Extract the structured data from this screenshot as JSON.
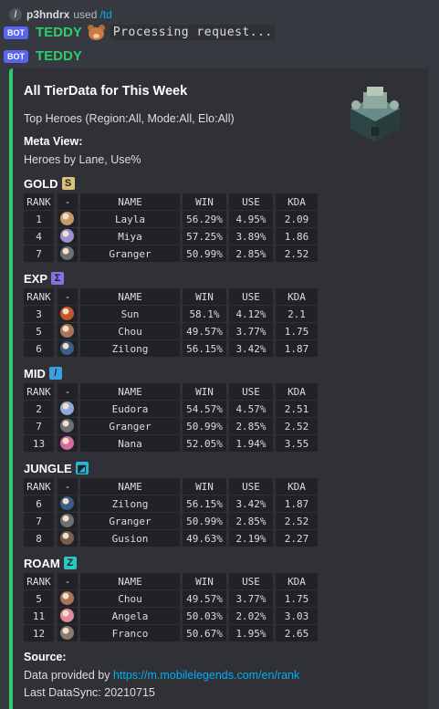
{
  "reply": {
    "slash": "/",
    "user": "p3hndrx",
    "used": "used",
    "command": "/td"
  },
  "bot": {
    "badge": "BOT",
    "name": "TEDDY",
    "processing": "Processing request..."
  },
  "embed": {
    "accent": "#2ecc71",
    "title": "All TierData for This Week",
    "subtitle": "Top Heroes (Region:All, Mode:All, Elo:All)",
    "meta_label": "Meta View:",
    "meta_value": "Heroes by Lane, Use%",
    "headers": {
      "rank": "RANK",
      "dash": "-",
      "name": "NAME",
      "win": "WIN",
      "use": "USE",
      "kda": "KDA"
    },
    "lanes": [
      {
        "title": "GOLD",
        "icon": "gold-lane-icon",
        "icon_color": "#d8c27a",
        "rows": [
          {
            "rank": "1",
            "name": "Layla",
            "win": "56.29%",
            "use": "4.95%",
            "kda": "2.09",
            "avatar": "#c9986a"
          },
          {
            "rank": "4",
            "name": "Miya",
            "win": "57.25%",
            "use": "3.89%",
            "kda": "1.86",
            "avatar": "#9b8fd6"
          },
          {
            "rank": "7",
            "name": "Granger",
            "win": "50.99%",
            "use": "2.85%",
            "kda": "2.52",
            "avatar": "#6d6f78"
          }
        ]
      },
      {
        "title": "EXP",
        "icon": "exp-lane-icon",
        "icon_color": "#8a6fe0",
        "rows": [
          {
            "rank": "3",
            "name": "Sun",
            "win": "58.1%",
            "use": "4.12%",
            "kda": "2.1",
            "avatar": "#c4552f"
          },
          {
            "rank": "5",
            "name": "Chou",
            "win": "49.57%",
            "use": "3.77%",
            "kda": "1.75",
            "avatar": "#a9745a"
          },
          {
            "rank": "6",
            "name": "Zilong",
            "win": "56.15%",
            "use": "3.42%",
            "kda": "1.87",
            "avatar": "#3d5d8a"
          }
        ]
      },
      {
        "title": "MID",
        "icon": "mid-lane-icon",
        "icon_color": "#3aa0e0",
        "rows": [
          {
            "rank": "2",
            "name": "Eudora",
            "win": "54.57%",
            "use": "4.57%",
            "kda": "2.51",
            "avatar": "#8fa9d8"
          },
          {
            "rank": "7",
            "name": "Granger",
            "win": "50.99%",
            "use": "2.85%",
            "kda": "2.52",
            "avatar": "#6d6f78"
          },
          {
            "rank": "13",
            "name": "Nana",
            "win": "52.05%",
            "use": "1.94%",
            "kda": "3.55",
            "avatar": "#d66aa0"
          }
        ]
      },
      {
        "title": "JUNGLE",
        "icon": "jungle-lane-icon",
        "icon_color": "#29b6d6",
        "rows": [
          {
            "rank": "6",
            "name": "Zilong",
            "win": "56.15%",
            "use": "3.42%",
            "kda": "1.87",
            "avatar": "#3d5d8a"
          },
          {
            "rank": "7",
            "name": "Granger",
            "win": "50.99%",
            "use": "2.85%",
            "kda": "2.52",
            "avatar": "#6d6f78"
          },
          {
            "rank": "8",
            "name": "Gusion",
            "win": "49.63%",
            "use": "2.19%",
            "kda": "2.27",
            "avatar": "#7a5e4c"
          }
        ]
      },
      {
        "title": "ROAM",
        "icon": "roam-lane-icon",
        "icon_color": "#2fc4c0",
        "rows": [
          {
            "rank": "5",
            "name": "Chou",
            "win": "49.57%",
            "use": "3.77%",
            "kda": "1.75",
            "avatar": "#a9745a"
          },
          {
            "rank": "11",
            "name": "Angela",
            "win": "50.03%",
            "use": "2.02%",
            "kda": "3.03",
            "avatar": "#e08a9a"
          },
          {
            "rank": "12",
            "name": "Franco",
            "win": "50.67%",
            "use": "1.95%",
            "kda": "2.65",
            "avatar": "#8a7a70"
          }
        ]
      }
    ],
    "source_label": "Source:",
    "source_prefix": "Data provided by ",
    "source_link": "https://m.mobilelegends.com/en/rank",
    "sync": "Last DataSync: 20210715"
  }
}
